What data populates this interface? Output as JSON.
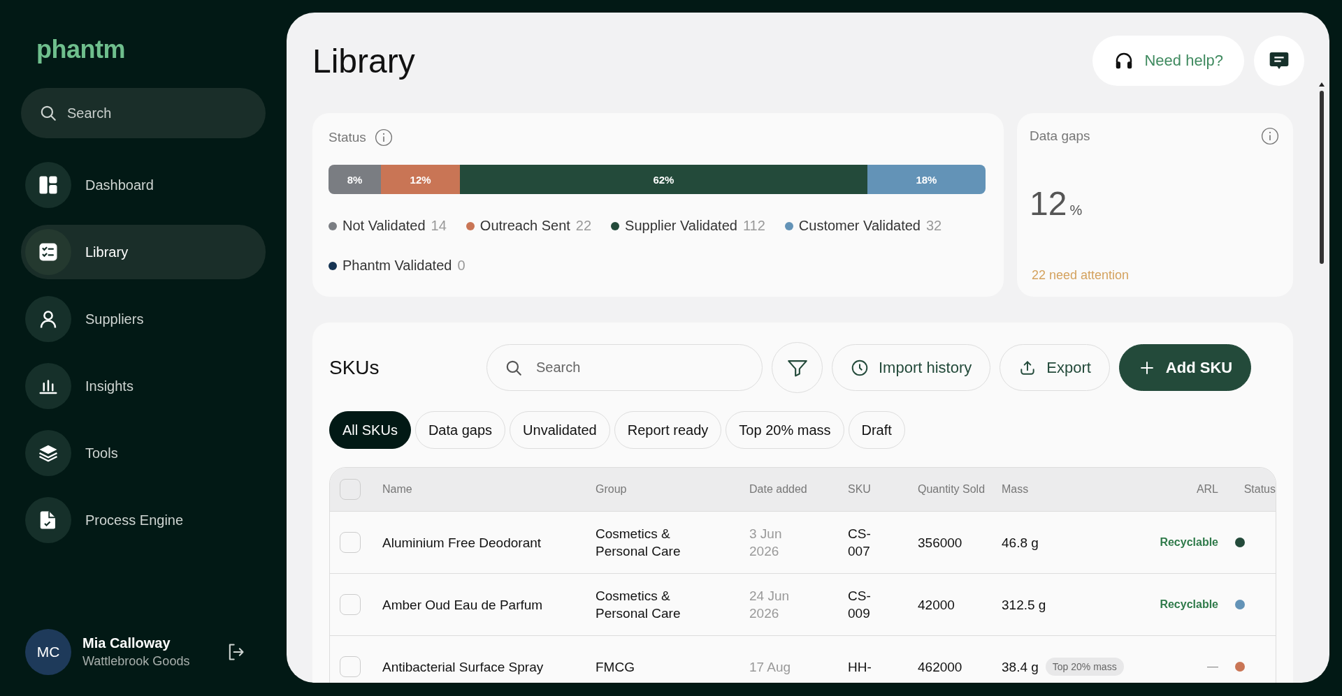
{
  "sidebar": {
    "logo": "phantm",
    "search": {
      "placeholder": "Search"
    },
    "items": [
      {
        "label": "Dashboard",
        "selected": false
      },
      {
        "label": "Library",
        "selected": true
      },
      {
        "label": "Suppliers",
        "selected": false
      },
      {
        "label": "Insights",
        "selected": false
      },
      {
        "label": "Tools",
        "selected": false
      },
      {
        "label": "Process Engine",
        "selected": false
      }
    ],
    "user": {
      "initials": "MC",
      "name": "Mia Calloway",
      "company": "Wattlebrook Goods"
    }
  },
  "header": {
    "title": "Library",
    "help_button": "Need help?"
  },
  "status_card": {
    "title": "Status",
    "segments": [
      {
        "label": "8%",
        "color": "#7a7d82"
      },
      {
        "label": "12%",
        "color": "#c97555"
      },
      {
        "label": "62%",
        "color": "#234a3a"
      },
      {
        "label": "18%",
        "color": "#6393b7"
      }
    ],
    "legend": [
      {
        "label": "Not Validated",
        "count": "14",
        "color": "#7a7d82"
      },
      {
        "label": "Outreach Sent",
        "count": "22",
        "color": "#c97555"
      },
      {
        "label": "Supplier Validated",
        "count": "112",
        "color": "#234a3a"
      },
      {
        "label": "Customer Validated",
        "count": "32",
        "color": "#6393b7"
      },
      {
        "label": "Phantm Validated",
        "count": "0",
        "color": "#163453"
      }
    ]
  },
  "data_gaps": {
    "title": "Data gaps",
    "value": "12",
    "unit": "%",
    "note": "22 need attention"
  },
  "skus": {
    "title": "SKUs",
    "search": {
      "placeholder": "Search"
    },
    "buttons": [
      {
        "label": "Import history",
        "kind": "history"
      },
      {
        "label": "Export",
        "kind": "export"
      },
      {
        "label": "Add SKU",
        "kind": "add"
      }
    ],
    "chips": [
      {
        "label": "All SKUs",
        "selected": true
      },
      {
        "label": "Data gaps",
        "selected": false
      },
      {
        "label": "Unvalidated",
        "selected": false
      },
      {
        "label": "Report ready",
        "selected": false
      },
      {
        "label": "Top 20% mass",
        "selected": false
      },
      {
        "label": "Draft",
        "selected": false
      }
    ],
    "select_all": {
      "checked": false
    },
    "columns": [
      "Name",
      "Group",
      "Date added",
      "SKU",
      "Quantity Sold",
      "Mass",
      "ARL",
      "Status"
    ],
    "rows": [
      {
        "checked": false,
        "kind": "recyclable",
        "name": "Aluminium Free Deodorant",
        "group": "Cosmetics & Personal Care",
        "date": "3 Jun 2026",
        "sku": "CS-007",
        "quantity": "356000",
        "mass": "46.8 g",
        "arl": "Recyclable",
        "color": "#234a3a"
      },
      {
        "checked": false,
        "kind": "recyclable",
        "name": "Amber Oud Eau de Parfum",
        "group": "Cosmetics & Personal Care",
        "date": "24 Jun 2026",
        "sku": "CS-009",
        "quantity": "42000",
        "mass": "312.5 g",
        "arl": "Recyclable",
        "color": "#6393b7"
      },
      {
        "checked": false,
        "kind": "unknown",
        "name": "Antibacterial Surface Spray",
        "group": "FMCG",
        "date": "17 Aug",
        "sku": "HH-",
        "quantity": "462000",
        "mass": "38.4 g",
        "badge": "Top 20% mass",
        "arl": "—",
        "color": "#c97555"
      }
    ]
  }
}
